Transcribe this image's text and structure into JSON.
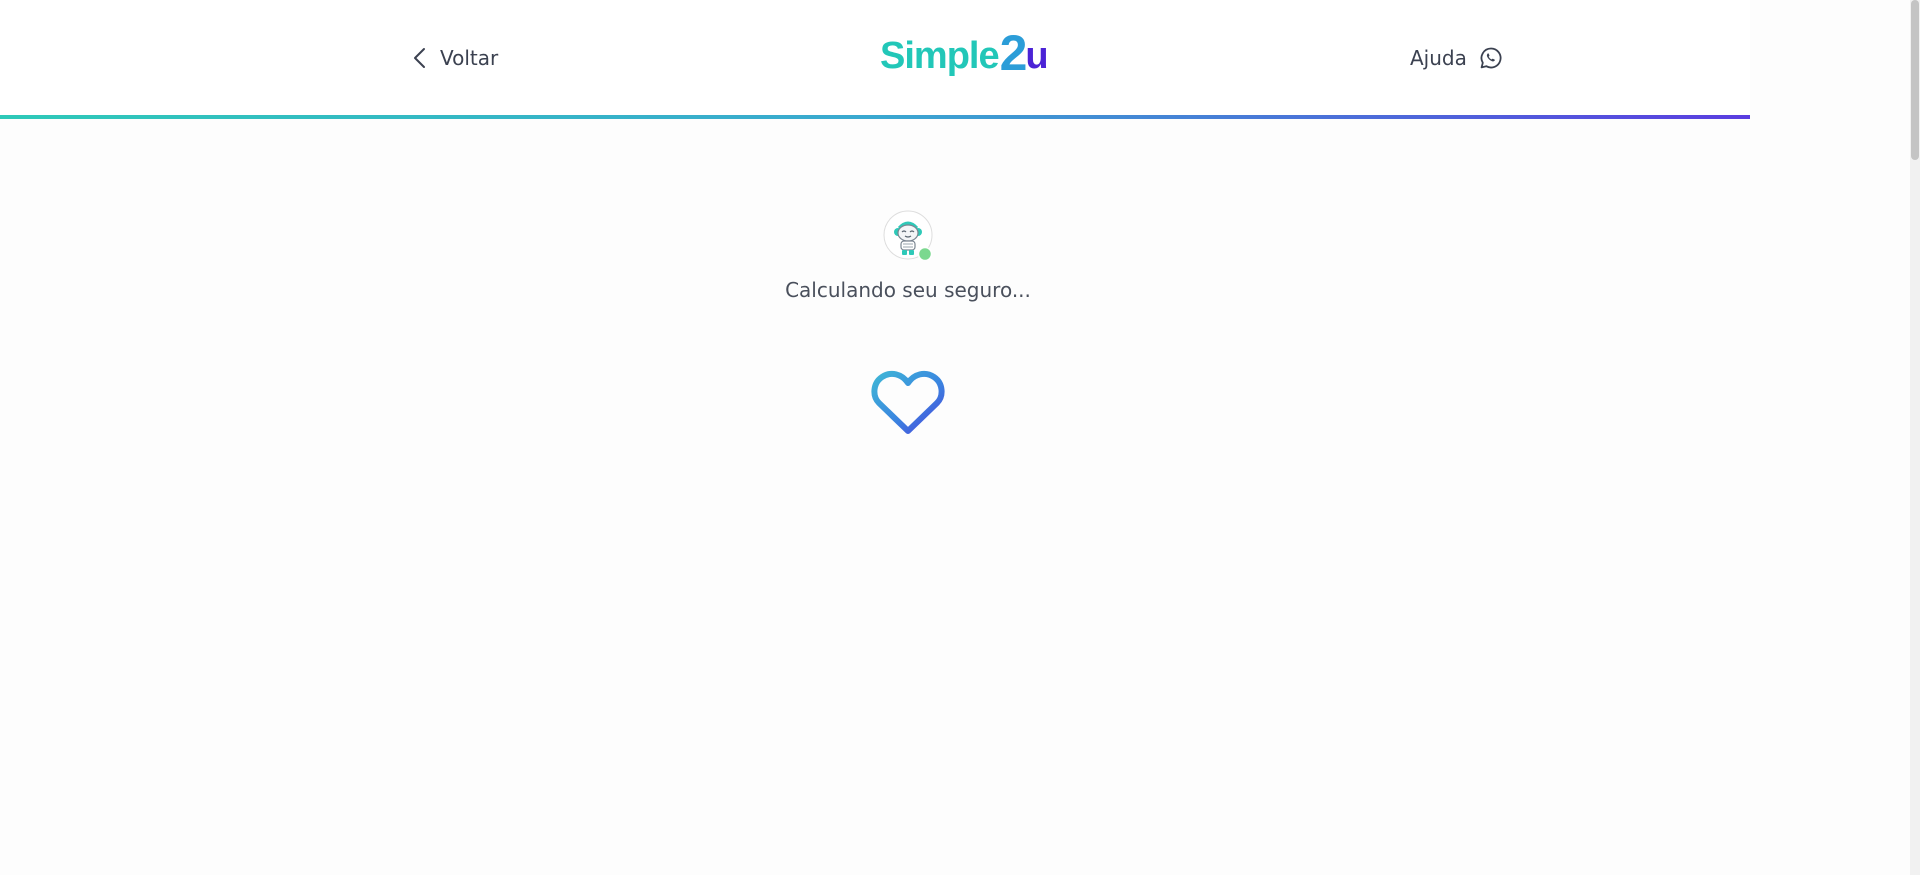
{
  "header": {
    "back_label": "Voltar",
    "logo": {
      "main": "Simple",
      "two": "2",
      "u": "u"
    },
    "help_label": "Ajuda"
  },
  "main": {
    "status_text": "Calculando seu seguro..."
  },
  "colors": {
    "teal": "#22c7b8",
    "blue": "#2b9dd8",
    "purple": "#4b23d6",
    "online": "#7bd88f"
  },
  "icons": {
    "back": "chevron-left-icon",
    "help": "whatsapp-icon",
    "avatar": "robot-avatar",
    "loading": "heart-icon"
  }
}
